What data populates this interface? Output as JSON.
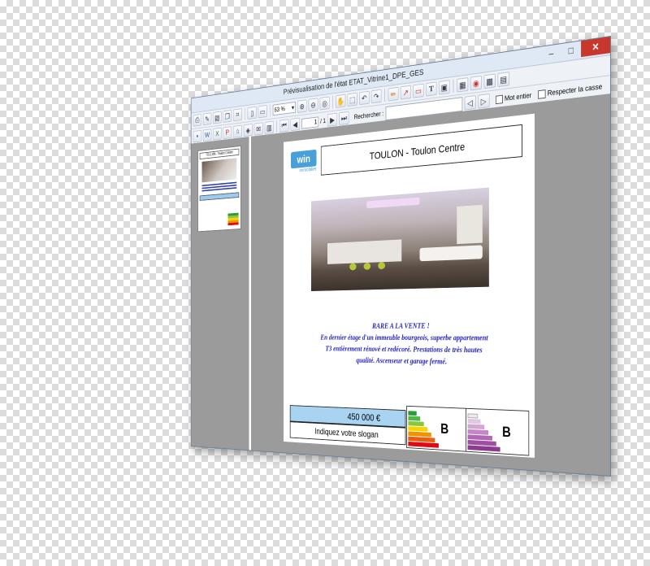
{
  "window": {
    "title": "Prévisualisation de l'état ETAT_Vitrine1_DPE_GES",
    "controls": {
      "minimize": "–",
      "maximize": "□",
      "close": "✕"
    }
  },
  "toolbar": {
    "zoom_value": "63 %",
    "current_page": "1",
    "total_pages": "/ 1",
    "search_label": "Rechercher :",
    "search_value": "",
    "whole_word_label": "Mot entier",
    "match_case_label": "Respecter la casse",
    "text_tool_glyph": "T"
  },
  "thumbnail": {
    "title": "TOULON - Toulon Centre"
  },
  "page": {
    "logo_text": "win",
    "logo_sub": "immobilier",
    "city": "TOULON - Toulon Centre",
    "description": [
      "RARE A LA VENTE !",
      "En dernier étage d'un immeuble bourgeois, superbe appartement",
      "T3 entièrement rénové et redécoré. Prestations de très hautes",
      "qualité. Ascenseur et garage fermé."
    ],
    "price": "450 000 €",
    "slogan": "Indiquez votre slogan",
    "dpe_grade": "B",
    "ges_grade": "B"
  },
  "colors": {
    "energy_a": "#2a9a3b",
    "energy_b": "#51b848",
    "energy_c": "#8cc63f",
    "energy_d": "#f6d400",
    "energy_e": "#f39200",
    "energy_f": "#e95d0f",
    "energy_g": "#e30613",
    "ges_light": "#f3e6f3",
    "ges_dark": "#8e3a8f",
    "price_bg": "#a8d4f2",
    "description_text": "#2424b8"
  }
}
